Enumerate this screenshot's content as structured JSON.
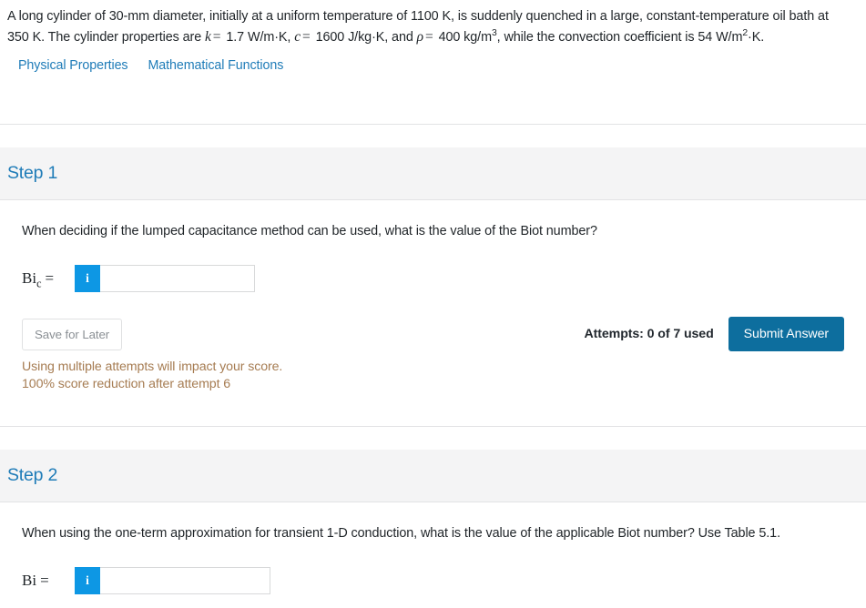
{
  "problem": {
    "line1_a": "A long cylinder of 30-mm diameter, initially at a uniform temperature of 1100 K, is suddenly quenched in a large, constant-temperature oil bath at 350 K. The cylinder properties are ",
    "k_symbol": "k",
    "eq1": "=",
    "k_value": "1.7 W/m·K, ",
    "c_symbol": "c",
    "eq2": "=",
    "c_value": "1600 J/kg·K, and ",
    "rho_symbol": "ρ",
    "eq3": "=",
    "rho_value_pre": "400 kg/m",
    "rho_exp": "3",
    "rho_value_post": ", while the convection coefficient is 54 W/m",
    "h_exp": "2",
    "h_value_post": "·K."
  },
  "resources": {
    "links": [
      {
        "label": "Physical Properties",
        "name": "physical-properties-link"
      },
      {
        "label": "Mathematical Functions",
        "name": "mathematical-functions-link"
      }
    ]
  },
  "steps": [
    {
      "title": "Step 1",
      "question": "When deciding if the lumped capacitance method can be used, what is the value of the Biot number?",
      "answer_label_base": "Bi",
      "answer_label_sub": "c",
      "answer_label_eq": "=",
      "info_icon": "i",
      "input_value": "",
      "input_placeholder": "",
      "save_label": "Save for Later",
      "attempts_label": "Attempts: 0 of 7 used",
      "submit_label": "Submit Answer",
      "warning_line1": "Using multiple attempts will impact your score.",
      "warning_line2": "100% score reduction after attempt 6"
    },
    {
      "title": "Step 2",
      "question": "When using the one-term approximation for transient 1-D conduction, what is the value of the applicable Biot number? Use Table 5.1.",
      "answer_label_base": "Bi",
      "answer_label_sub": "",
      "answer_label_eq": "=",
      "info_icon": "i",
      "input_value": "",
      "input_placeholder": ""
    }
  ],
  "colors": {
    "link_blue": "#1f7cb8",
    "info_blue": "#0d97e4",
    "submit_blue": "#0d6e9e",
    "warning_brown": "#a67c52",
    "band_gray": "#f4f4f5",
    "rule_gray": "#e2e3e5"
  }
}
